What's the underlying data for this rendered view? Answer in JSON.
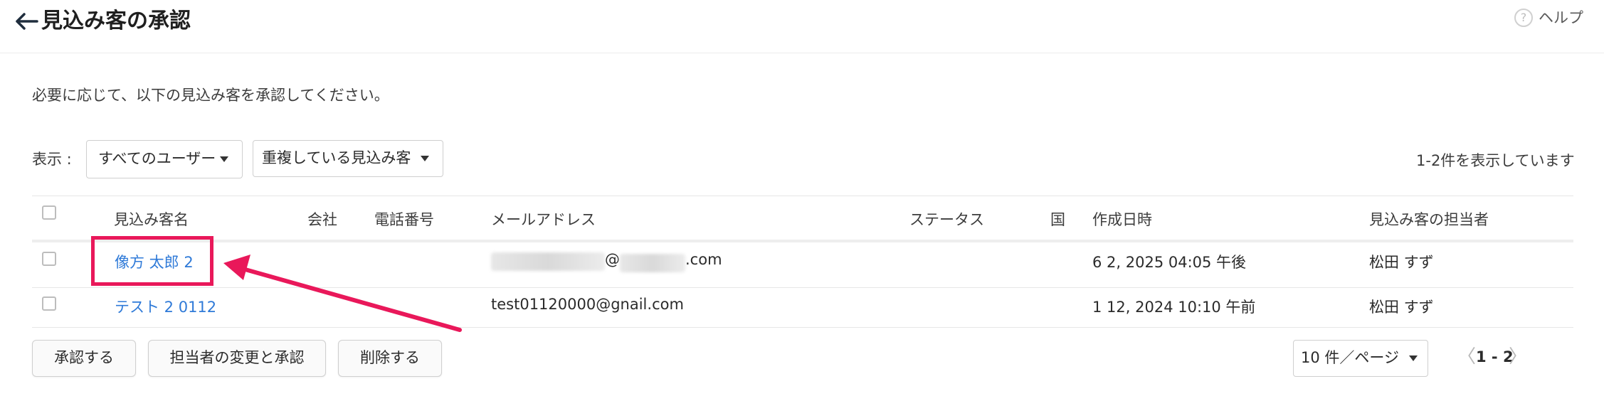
{
  "header": {
    "title": "見込み客の承認",
    "help_label": "ヘルプ",
    "help_icon": "?"
  },
  "instruction": "必要に応じて、以下の見込み客を承認してください。",
  "filters": {
    "display_label": "表示 :",
    "user_filter": "すべてのユーザー",
    "duplicate_filter": "重複している見込み客"
  },
  "result_count": "1-2件を表示しています",
  "table": {
    "columns": [
      "見込み客名",
      "会社",
      "電話番号",
      "メールアドレス",
      "ステータス",
      "国",
      "作成日時",
      "見込み客の担当者"
    ],
    "rows": [
      {
        "name": "像方 太郎 2",
        "company": "",
        "phone": "",
        "email_at": "@",
        "email_suffix": ".com",
        "status": "",
        "country": "",
        "created": "6 2, 2025 04:05 午後",
        "owner": "松田 すず"
      },
      {
        "name": "テスト 2 0112",
        "company": "",
        "phone": "",
        "email": "test01120000@gnail.com",
        "status": "",
        "country": "",
        "created": "1 12, 2024 10:10 午前",
        "owner": "松田 すず"
      }
    ]
  },
  "actions": {
    "approve": "承認する",
    "change_owner_approve": "担当者の変更と承認",
    "delete": "削除する"
  },
  "pagination": {
    "page_size": "10 件／ページ",
    "range": "1 - 2",
    "prev": "〈",
    "next": "〉"
  },
  "colors": {
    "link": "#2f7ad8",
    "highlight": "#e9185a"
  }
}
